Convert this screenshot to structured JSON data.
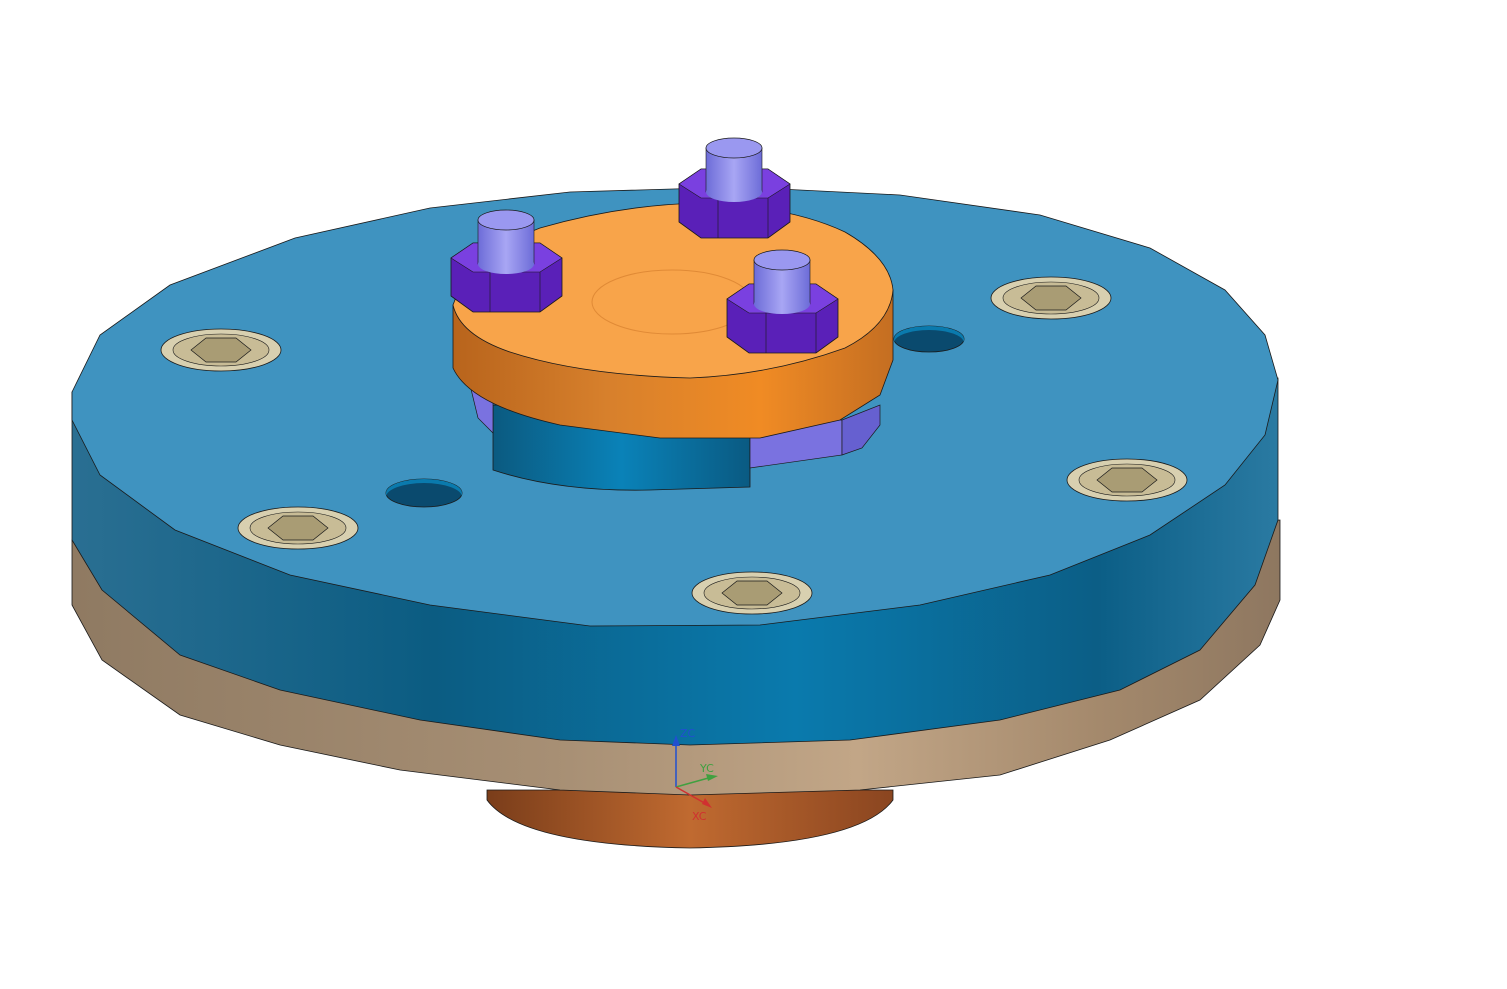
{
  "viewport": {
    "background": "#ffffff"
  },
  "colors": {
    "flange_top": "#3f93c0",
    "flange_side": "#0c6a94",
    "flange_side_dark": "#0a4e70",
    "base_plate": "#a8927a",
    "base_plate_light": "#bda285",
    "hub_bottom": "#b8632d",
    "hub_bottom_dark": "#7a3d1a",
    "orange_cap_top": "#f8a44a",
    "orange_cap_side": "#e58930",
    "orange_cap_side_dark": "#b8641c",
    "purple_nut": "#6a2ad0",
    "purple_nut_dark": "#4d1aa0",
    "stud_top": "#9a98f0",
    "stud_side": "#7f7ee0",
    "washer": "#d8d0b0",
    "socket": "#b8ab86",
    "lavender_tab": "#7a72e0",
    "edge": "#1a1a1a"
  },
  "triad": {
    "zc_label": "ZC",
    "yc_label": "YC",
    "xc_label": "XC",
    "zc_color": "#2050d0",
    "yc_color": "#40a040",
    "xc_color": "#d03030"
  }
}
